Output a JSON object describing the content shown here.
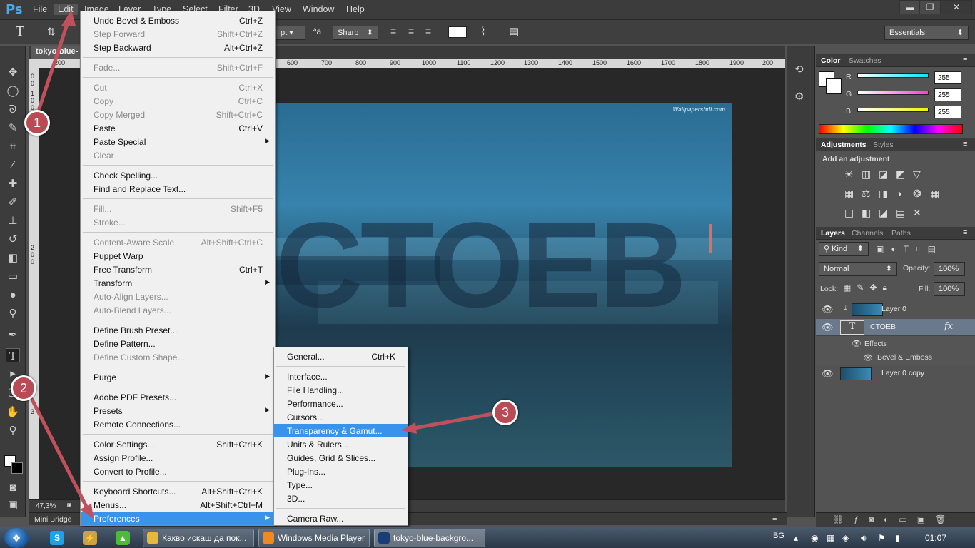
{
  "app": {
    "logo": "Ps",
    "menus": [
      "File",
      "Edit",
      "Image",
      "Layer",
      "Type",
      "Select",
      "Filter",
      "3D",
      "View",
      "Window",
      "Help"
    ],
    "window_controls": {
      "minimize": "▬",
      "maximize": "❐",
      "close": "✕"
    }
  },
  "options_bar": {
    "tool_glyph": "T",
    "font_size_unit": "pt",
    "anti_alias_glyph": "ªa",
    "anti_alias": "Sharp",
    "workspace": "Essentials"
  },
  "document": {
    "tab": "tokyo-blue-",
    "ruler_marks": [
      "600",
      "700",
      "800",
      "900",
      "1000",
      "1100",
      "1200",
      "1300",
      "1400",
      "1500",
      "1600",
      "1700",
      "1800",
      "1900",
      "200"
    ],
    "ruler_left_marks": [
      "0",
      "0",
      "1",
      "0",
      "0",
      "2",
      "0",
      "0",
      "3"
    ],
    "ruler_origin_mark": "200",
    "watermark": "Wallpapershdi.com",
    "big_text": "CTOEB",
    "zoom": "47,3%",
    "minibridge": "Mini Bridge"
  },
  "edit_menu": [
    {
      "label": "Undo Bevel & Emboss",
      "shortcut": "Ctrl+Z",
      "disabled": false
    },
    {
      "label": "Step Forward",
      "shortcut": "Shift+Ctrl+Z",
      "disabled": true
    },
    {
      "label": "Step Backward",
      "shortcut": "Alt+Ctrl+Z",
      "disabled": false
    },
    {
      "sep": true
    },
    {
      "label": "Fade...",
      "shortcut": "Shift+Ctrl+F",
      "disabled": true
    },
    {
      "sep": true
    },
    {
      "label": "Cut",
      "shortcut": "Ctrl+X",
      "disabled": true
    },
    {
      "label": "Copy",
      "shortcut": "Ctrl+C",
      "disabled": true
    },
    {
      "label": "Copy Merged",
      "shortcut": "Shift+Ctrl+C",
      "disabled": true
    },
    {
      "label": "Paste",
      "shortcut": "Ctrl+V",
      "disabled": false
    },
    {
      "label": "Paste Special",
      "shortcut": "",
      "disabled": false,
      "submenu": true
    },
    {
      "label": "Clear",
      "shortcut": "",
      "disabled": true
    },
    {
      "sep": true
    },
    {
      "label": "Check Spelling...",
      "shortcut": "",
      "disabled": false
    },
    {
      "label": "Find and Replace Text...",
      "shortcut": "",
      "disabled": false
    },
    {
      "sep": true
    },
    {
      "label": "Fill...",
      "shortcut": "Shift+F5",
      "disabled": true
    },
    {
      "label": "Stroke...",
      "shortcut": "",
      "disabled": true
    },
    {
      "sep": true
    },
    {
      "label": "Content-Aware Scale",
      "shortcut": "Alt+Shift+Ctrl+C",
      "disabled": true
    },
    {
      "label": "Puppet Warp",
      "shortcut": "",
      "disabled": false
    },
    {
      "label": "Free Transform",
      "shortcut": "Ctrl+T",
      "disabled": false
    },
    {
      "label": "Transform",
      "shortcut": "",
      "disabled": false,
      "submenu": true
    },
    {
      "label": "Auto-Align Layers...",
      "shortcut": "",
      "disabled": true
    },
    {
      "label": "Auto-Blend Layers...",
      "shortcut": "",
      "disabled": true
    },
    {
      "sep": true
    },
    {
      "label": "Define Brush Preset...",
      "shortcut": "",
      "disabled": false
    },
    {
      "label": "Define Pattern...",
      "shortcut": "",
      "disabled": false
    },
    {
      "label": "Define Custom Shape...",
      "shortcut": "",
      "disabled": true
    },
    {
      "sep": true
    },
    {
      "label": "Purge",
      "shortcut": "",
      "disabled": false,
      "submenu": true
    },
    {
      "sep": true
    },
    {
      "label": "Adobe PDF Presets...",
      "shortcut": "",
      "disabled": false
    },
    {
      "label": "Presets",
      "shortcut": "",
      "disabled": false,
      "submenu": true
    },
    {
      "label": "Remote Connections...",
      "shortcut": "",
      "disabled": false
    },
    {
      "sep": true
    },
    {
      "label": "Color Settings...",
      "shortcut": "Shift+Ctrl+K",
      "disabled": false
    },
    {
      "label": "Assign Profile...",
      "shortcut": "",
      "disabled": false
    },
    {
      "label": "Convert to Profile...",
      "shortcut": "",
      "disabled": false
    },
    {
      "sep": true
    },
    {
      "label": "Keyboard Shortcuts...",
      "shortcut": "Alt+Shift+Ctrl+K",
      "disabled": false
    },
    {
      "label": "Menus...",
      "shortcut": "Alt+Shift+Ctrl+M",
      "disabled": false
    },
    {
      "label": "Preferences",
      "shortcut": "",
      "disabled": false,
      "submenu": true,
      "highlight": true
    }
  ],
  "pref_menu": [
    {
      "label": "General...",
      "shortcut": "Ctrl+K"
    },
    {
      "sep": true
    },
    {
      "label": "Interface...",
      "shortcut": ""
    },
    {
      "label": "File Handling...",
      "shortcut": ""
    },
    {
      "label": "Performance...",
      "shortcut": ""
    },
    {
      "label": "Cursors...",
      "shortcut": ""
    },
    {
      "label": "Transparency & Gamut...",
      "shortcut": "",
      "highlight": true
    },
    {
      "label": "Units & Rulers...",
      "shortcut": ""
    },
    {
      "label": "Guides, Grid & Slices...",
      "shortcut": ""
    },
    {
      "label": "Plug-Ins...",
      "shortcut": ""
    },
    {
      "label": "Type...",
      "shortcut": ""
    },
    {
      "label": "3D...",
      "shortcut": ""
    },
    {
      "sep": true
    },
    {
      "label": "Camera Raw...",
      "shortcut": ""
    }
  ],
  "color_panel": {
    "tabs": [
      "Color",
      "Swatches"
    ],
    "channels": [
      {
        "name": "R",
        "value": "255",
        "color": "#00e5ff"
      },
      {
        "name": "G",
        "value": "255",
        "color": "#ff3bd6"
      },
      {
        "name": "B",
        "value": "255",
        "color": "#f2f200"
      }
    ]
  },
  "adjustments_panel": {
    "tabs": [
      "Adjustments",
      "Styles"
    ],
    "title": "Add an adjustment"
  },
  "layers_panel": {
    "tabs": [
      "Layers",
      "Channels",
      "Paths"
    ],
    "filter": "Kind",
    "blend_mode": "Normal",
    "opacity_label": "Opacity:",
    "opacity": "100%",
    "lock_label": "Lock:",
    "fill_label": "Fill:",
    "fill": "100%",
    "layers": [
      {
        "name": "Layer 0",
        "type": "image"
      },
      {
        "name": "CTOEB",
        "type": "text",
        "fx": "fx"
      },
      {
        "name": "Effects",
        "type": "effects"
      },
      {
        "name": "Bevel & Emboss",
        "type": "effect"
      },
      {
        "name": "Layer 0 copy",
        "type": "image"
      }
    ]
  },
  "taskbar": {
    "apps": [
      {
        "label": "Какво искаш да пок...",
        "color": "#e9b73b"
      },
      {
        "label": "Windows Media Player",
        "color": "#f08a1e"
      },
      {
        "label": "tokyo-blue-backgro...",
        "color": "#1a3d78"
      }
    ],
    "pins": [
      {
        "label": "S",
        "color": "#1aa3e8"
      },
      {
        "label": "⚡",
        "color": "#c9a24a"
      },
      {
        "label": "▲",
        "color": "#4dbb3a"
      }
    ],
    "language": "BG",
    "time": "01:07"
  },
  "annotations": [
    "1",
    "2",
    "3"
  ]
}
